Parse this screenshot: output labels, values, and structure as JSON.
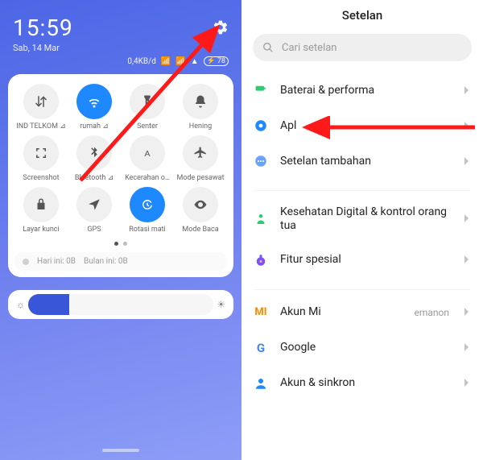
{
  "left": {
    "time": "15:59",
    "date": "Sab, 14 Mar",
    "status": {
      "data_rate": "0,4KB/d",
      "battery_text": "78"
    },
    "tiles": [
      {
        "label": "IND TELKOM ⊿",
        "icon": "swap-vertical-icon",
        "on": false
      },
      {
        "label": "rumah ⊿",
        "icon": "wifi-icon",
        "on": true
      },
      {
        "label": "Senter",
        "icon": "flashlight-icon",
        "on": false
      },
      {
        "label": "Hening",
        "icon": "bell-icon",
        "on": false
      },
      {
        "label": "Screenshot",
        "icon": "screenshot-icon",
        "on": false
      },
      {
        "label": "Bluetooth ⊿",
        "icon": "bluetooth-icon",
        "on": false
      },
      {
        "label": "Kecerahan o…",
        "icon": "letter-a-icon",
        "on": false
      },
      {
        "label": "Mode pesawat",
        "icon": "airplane-icon",
        "on": false
      },
      {
        "label": "Layar kunci",
        "icon": "lock-icon",
        "on": false
      },
      {
        "label": "GPS",
        "icon": "location-icon",
        "on": false
      },
      {
        "label": "Rotasi mati",
        "icon": "rotation-lock-icon",
        "on": true
      },
      {
        "label": "Mode Baca",
        "icon": "eye-icon",
        "on": false
      }
    ],
    "usage_today": "Hari ini: 0B",
    "usage_month": "Bulan ini: 0B"
  },
  "right": {
    "title": "Setelan",
    "search_placeholder": "Cari setelan",
    "groups": [
      [
        {
          "icon": "battery-horiz-icon",
          "color": "#2ecc71",
          "label": "Baterai & performa"
        },
        {
          "icon": "gear-solid-icon",
          "color": "#1e88ff",
          "label": "Apl"
        },
        {
          "icon": "dots-circle-icon",
          "color": "#6aa2ff",
          "label": "Setelan tambahan"
        }
      ],
      [
        {
          "icon": "wellbeing-icon",
          "color": "#2ecc71",
          "label": "Kesehatan Digital & kontrol orang tua"
        },
        {
          "icon": "potion-icon",
          "color": "#7a52ff",
          "label": "Fitur spesial"
        }
      ],
      [
        {
          "icon": "mi-logo-icon",
          "color": "#ff8a00",
          "label": "Akun Mi",
          "sub": "emanon"
        },
        {
          "icon": "google-logo-icon",
          "color": "",
          "label": "Google"
        },
        {
          "icon": "person-sync-icon",
          "color": "#1e88ff",
          "label": "Akun & sinkron"
        }
      ]
    ]
  }
}
